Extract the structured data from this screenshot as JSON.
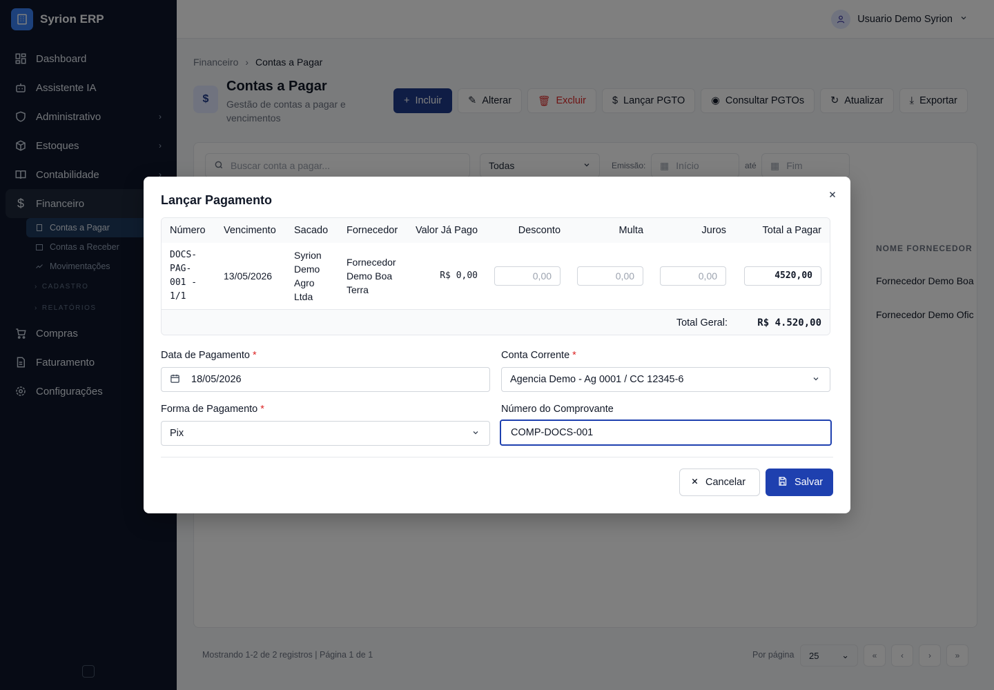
{
  "brand": {
    "name": "Syrion ERP"
  },
  "sidebar": {
    "items": [
      {
        "label": "Dashboard"
      },
      {
        "label": "Assistente IA"
      },
      {
        "label": "Administrativo"
      },
      {
        "label": "Estoques"
      },
      {
        "label": "Contabilidade"
      },
      {
        "label": "Financeiro"
      },
      {
        "label": "Compras"
      },
      {
        "label": "Faturamento"
      },
      {
        "label": "Configurações"
      }
    ],
    "financeiro_sub": [
      {
        "label": "Contas a Pagar"
      },
      {
        "label": "Contas a Receber"
      },
      {
        "label": "Movimentações"
      }
    ],
    "groups": [
      {
        "label": "CADASTRO"
      },
      {
        "label": "RELATÓRIOS"
      }
    ]
  },
  "header": {
    "user_name": "Usuario Demo Syrion"
  },
  "breadcrumb": {
    "parent": "Financeiro",
    "current": "Contas a Pagar"
  },
  "page": {
    "title": "Contas a Pagar",
    "subtitle": "Gestão de contas a pagar e vencimentos"
  },
  "toolbar": {
    "incluir": "Incluir",
    "alterar": "Alterar",
    "excluir": "Excluir",
    "lancar": "Lançar PGTO",
    "consultar": "Consultar PGTOs",
    "atualizar": "Atualizar",
    "exportar": "Exportar"
  },
  "filters": {
    "search_placeholder": "Buscar conta a pagar...",
    "status": "Todas",
    "emissao_label": "Emissão:",
    "inicio_placeholder": "Início",
    "ate_label": "até",
    "fim_placeholder": "Fim"
  },
  "background_table": {
    "fornecedor_header": "NOME FORNECEDOR",
    "rows": [
      {
        "fornecedor": "Fornecedor Demo Boa"
      },
      {
        "fornecedor": "Fornecedor Demo Ofic"
      }
    ]
  },
  "pagination": {
    "info": "Mostrando 1-2 de 2 registros | Página 1 de 1",
    "per_page_label": "Por página",
    "per_page": "25"
  },
  "modal": {
    "title": "Lançar Pagamento",
    "columns": [
      "Número",
      "Vencimento",
      "Sacado",
      "Fornecedor",
      "Valor Já Pago",
      "Desconto",
      "Multa",
      "Juros",
      "Total a Pagar"
    ],
    "row": {
      "numero": "DOCS-PAG-001 - 1/1",
      "vencimento": "13/05/2026",
      "sacado": "Syrion Demo Agro Ltda",
      "fornecedor": "Fornecedor Demo Boa Terra",
      "valor_pago": "R$ 0,00",
      "desconto_placeholder": "0,00",
      "multa_placeholder": "0,00",
      "juros_placeholder": "0,00",
      "total": "4520,00"
    },
    "total_label": "Total Geral:",
    "total_value": "R$ 4.520,00",
    "data_pagamento": {
      "label": "Data de Pagamento",
      "value": "18/05/2026"
    },
    "conta_corrente": {
      "label": "Conta Corrente",
      "value": "Agencia Demo - Ag 0001 / CC 12345-6"
    },
    "forma_pagamento": {
      "label": "Forma de Pagamento",
      "value": "Pix"
    },
    "comprovante": {
      "label": "Número do Comprovante",
      "value": "COMP-DOCS-001"
    },
    "required_mark": "*",
    "cancel": "Cancelar",
    "save": "Salvar"
  },
  "colors": {
    "primary": "#1e40af",
    "sidebar_bg": "#0f172a",
    "danger": "#dc2626"
  }
}
